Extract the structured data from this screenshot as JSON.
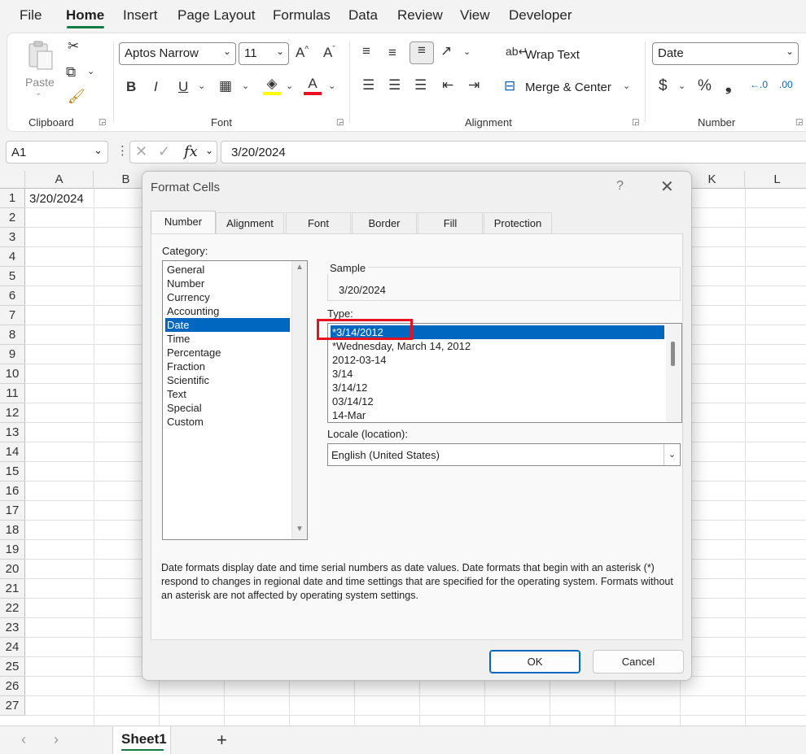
{
  "menu": {
    "items": [
      "File",
      "Home",
      "Insert",
      "Page Layout",
      "Formulas",
      "Data",
      "Review",
      "View",
      "Developer"
    ],
    "active": "Home"
  },
  "ribbon": {
    "clipboard": {
      "paste_label": "Paste",
      "group_label": "Clipboard"
    },
    "font": {
      "font_name": "Aptos Narrow",
      "font_size": "11",
      "bold": "B",
      "italic": "I",
      "underline": "U",
      "group_label": "Font"
    },
    "alignment": {
      "wrap_text": "Wrap Text",
      "merge_center": "Merge & Center",
      "group_label": "Alignment"
    },
    "number": {
      "format": "Date",
      "currency": "$",
      "percent": "%",
      "comma": "❟",
      "group_label": "Number"
    }
  },
  "formula_bar": {
    "name_box": "A1",
    "fx": "fx",
    "value": "3/20/2024"
  },
  "grid": {
    "columns": [
      "A",
      "B",
      "K",
      "L"
    ],
    "rows": [
      "1",
      "2",
      "3",
      "4",
      "5",
      "6",
      "7",
      "8",
      "9",
      "10",
      "11",
      "12",
      "13",
      "14",
      "15",
      "16",
      "17",
      "18",
      "19",
      "20",
      "21",
      "22",
      "23",
      "24",
      "25",
      "26",
      "27"
    ],
    "a1_value": "3/20/2024"
  },
  "sheet_tabs": {
    "active": "Sheet1",
    "add": "+"
  },
  "dialog": {
    "title": "Format Cells",
    "help": "?",
    "tabs": [
      "Number",
      "Alignment",
      "Font",
      "Border",
      "Fill",
      "Protection"
    ],
    "active_tab": "Number",
    "category_label": "Category:",
    "categories": [
      "General",
      "Number",
      "Currency",
      "Accounting",
      "Date",
      "Time",
      "Percentage",
      "Fraction",
      "Scientific",
      "Text",
      "Special",
      "Custom"
    ],
    "selected_category": "Date",
    "sample_label": "Sample",
    "sample_value": "3/20/2024",
    "type_label": "Type:",
    "types": [
      "*3/14/2012",
      "*Wednesday, March 14, 2012",
      "2012-03-14",
      "3/14",
      "3/14/12",
      "03/14/12",
      "14-Mar"
    ],
    "selected_type": "*3/14/2012",
    "locale_label": "Locale (location):",
    "locale_value": "English (United States)",
    "description": "Date formats display date and time serial numbers as date values.  Date formats that begin with an asterisk (*) respond to changes in regional date and time settings that are specified for the operating system. Formats without an asterisk are not affected by operating system settings.",
    "ok": "OK",
    "cancel": "Cancel"
  },
  "colors": {
    "accent": "#107c41",
    "selection": "#0067c0",
    "highlight": "#e8111f"
  }
}
